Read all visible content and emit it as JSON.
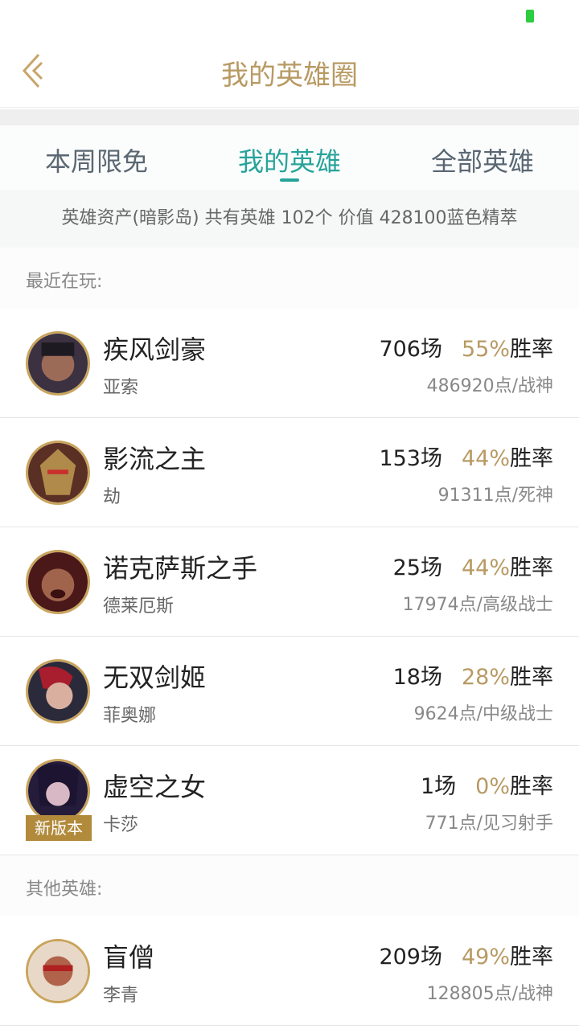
{
  "header": {
    "title": "我的英雄圈"
  },
  "tabs": [
    {
      "label": "本周限免",
      "active": false
    },
    {
      "label": "我的英雄",
      "active": true
    },
    {
      "label": "全部英雄",
      "active": false
    }
  ],
  "summary": "英雄资产(暗影岛)  共有英雄 102个  价值 428100蓝色精萃",
  "sections": {
    "recent": "最近在玩:",
    "others": "其他英雄:"
  },
  "heroes": [
    {
      "name": "疾风剑豪",
      "sub": "亚索",
      "games": "706场",
      "rate": "55%",
      "rate_suffix": "胜率",
      "points": "486920点/战神"
    },
    {
      "name": "影流之主",
      "sub": "劫",
      "games": "153场",
      "rate": "44%",
      "rate_suffix": "胜率",
      "points": "91311点/死神"
    },
    {
      "name": "诺克萨斯之手",
      "sub": "德莱厄斯",
      "games": "25场",
      "rate": "44%",
      "rate_suffix": "胜率",
      "points": "17974点/高级战士"
    },
    {
      "name": "无双剑姬",
      "sub": "菲奥娜",
      "games": "18场",
      "rate": "28%",
      "rate_suffix": "胜率",
      "points": "9624点/中级战士"
    },
    {
      "name": "虚空之女",
      "sub": "卡莎",
      "games": "1场",
      "rate": "0%",
      "rate_suffix": "胜率",
      "points": "771点/见习射手",
      "badge": "新版本"
    },
    {
      "name": "盲僧",
      "sub": "李青",
      "games": "209场",
      "rate": "49%",
      "rate_suffix": "胜率",
      "points": "128805点/战神"
    }
  ],
  "colors": {
    "accent": "#b89a63",
    "tab_active": "#27a39a",
    "badge": "#b18a3b"
  }
}
